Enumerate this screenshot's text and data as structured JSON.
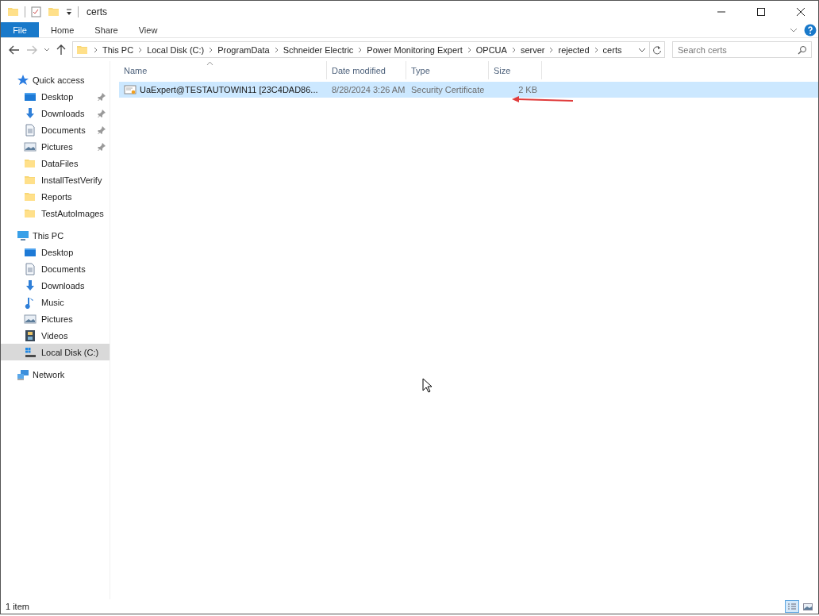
{
  "window": {
    "title": "certs"
  },
  "ribbon": {
    "file_button": "File",
    "tabs": [
      "Home",
      "Share",
      "View"
    ]
  },
  "address_bar": {
    "path": [
      "This PC",
      "Local Disk (C:)",
      "ProgramData",
      "Schneider Electric",
      "Power Monitoring Expert",
      "OPCUA",
      "server",
      "rejected",
      "certs"
    ]
  },
  "search": {
    "placeholder": "Search certs"
  },
  "nav": {
    "sections": [
      {
        "label": "Quick access",
        "kind": "star",
        "selected": false,
        "children": [
          {
            "label": "Desktop",
            "kind": "desktop",
            "pinned": true,
            "selected": false
          },
          {
            "label": "Downloads",
            "kind": "download",
            "pinned": true,
            "selected": false
          },
          {
            "label": "Documents",
            "kind": "document",
            "pinned": true,
            "selected": false
          },
          {
            "label": "Pictures",
            "kind": "pictures",
            "pinned": true,
            "selected": false
          },
          {
            "label": "DataFiles",
            "kind": "folder",
            "pinned": false,
            "selected": false
          },
          {
            "label": "InstallTestVerify",
            "kind": "folder",
            "pinned": false,
            "selected": false
          },
          {
            "label": "Reports",
            "kind": "folder",
            "pinned": false,
            "selected": false
          },
          {
            "label": "TestAutoImages",
            "kind": "folder",
            "pinned": false,
            "selected": false
          }
        ]
      },
      {
        "label": "This PC",
        "kind": "pc",
        "selected": false,
        "children": [
          {
            "label": "Desktop",
            "kind": "desktop",
            "pinned": false,
            "selected": false
          },
          {
            "label": "Documents",
            "kind": "document",
            "pinned": false,
            "selected": false
          },
          {
            "label": "Downloads",
            "kind": "download",
            "pinned": false,
            "selected": false
          },
          {
            "label": "Music",
            "kind": "music",
            "pinned": false,
            "selected": false
          },
          {
            "label": "Pictures",
            "kind": "pictures",
            "pinned": false,
            "selected": false
          },
          {
            "label": "Videos",
            "kind": "videos",
            "pinned": false,
            "selected": false
          },
          {
            "label": "Local Disk (C:)",
            "kind": "disk",
            "pinned": false,
            "selected": true
          }
        ]
      },
      {
        "label": "Network",
        "kind": "network",
        "selected": false
      }
    ]
  },
  "file_list": {
    "columns": [
      "Name",
      "Date modified",
      "Type",
      "Size"
    ],
    "rows": [
      {
        "name": "UaExpert@TESTAUTOWIN11 [23C4DAD86...",
        "date_modified": "8/28/2024 3:26 AM",
        "type": "Security Certificate",
        "size": "2 KB",
        "selected": true
      }
    ]
  },
  "status_bar": {
    "item_count": "1 item"
  },
  "view_buttons": [
    {
      "kind": "details",
      "selected": true
    },
    {
      "kind": "tiles",
      "selected": false
    }
  ]
}
